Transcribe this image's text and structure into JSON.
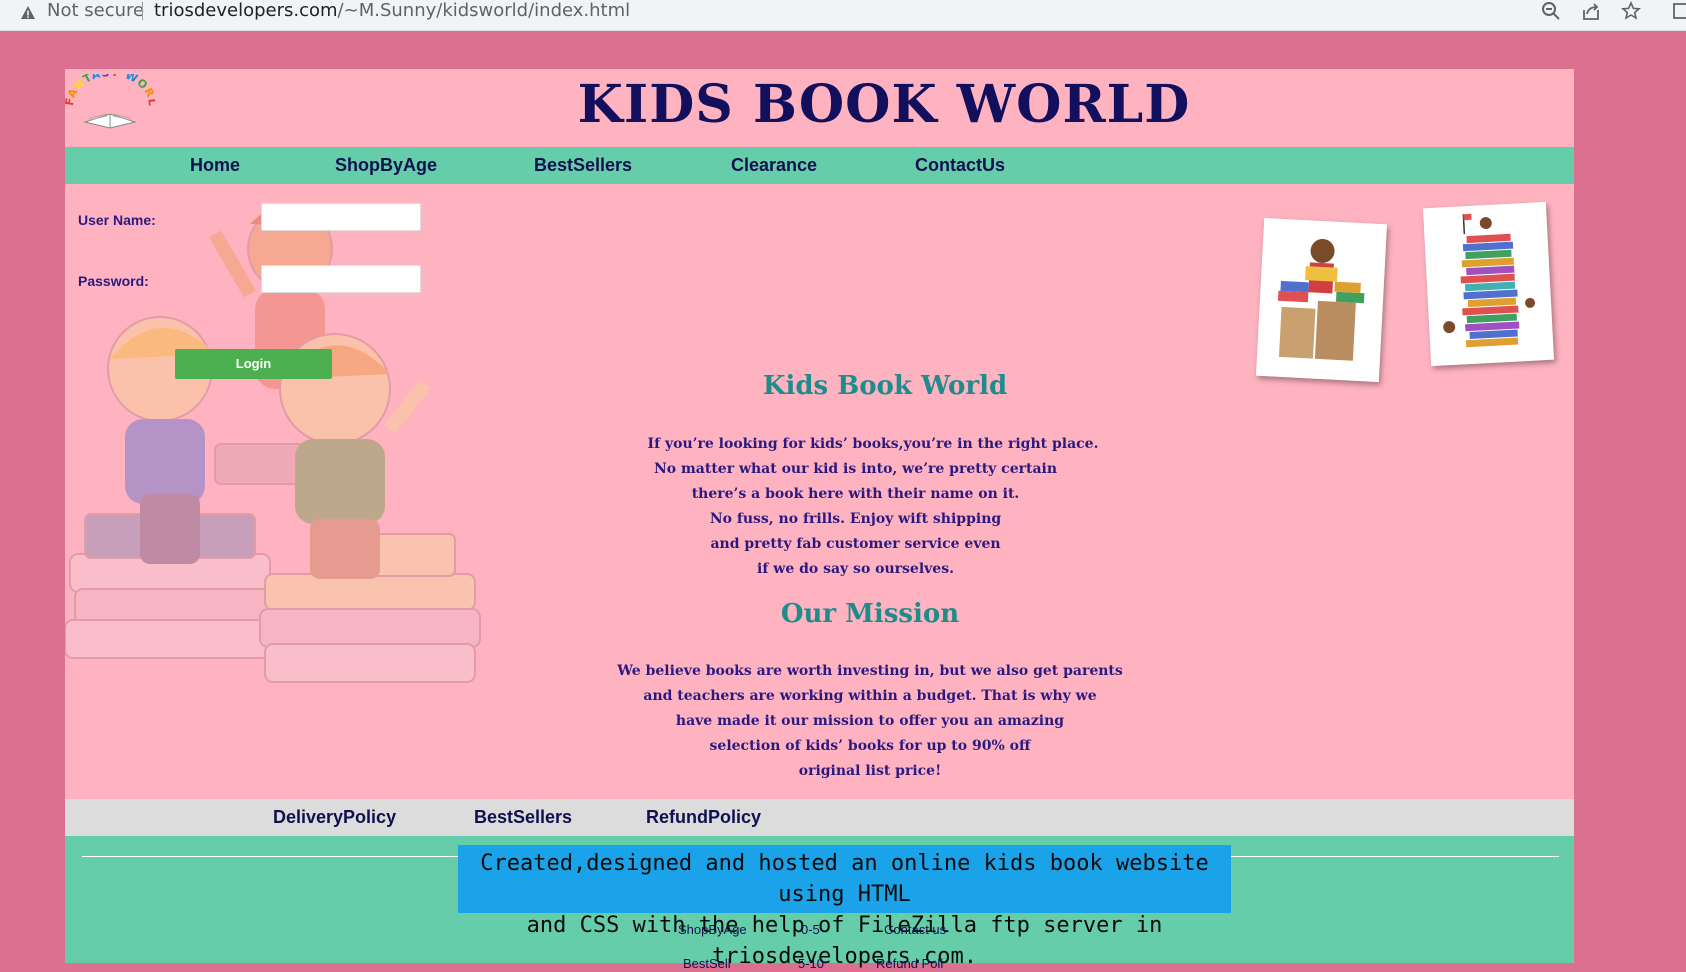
{
  "browser": {
    "security_label": "Not secure",
    "url_host": "triosdevelopers.com",
    "url_path": "/~M.Sunny/kidsworld/index.html"
  },
  "header": {
    "logo_text": "FANTASY WORLD",
    "title": "KIDS BOOK WORLD"
  },
  "nav": {
    "home": "Home",
    "shop_by_age": "ShopByAge",
    "bestsellers": "BestSellers",
    "clearance": "Clearance",
    "contact": "ContactUs"
  },
  "login": {
    "username_label": "User Name:",
    "password_label": "Password:",
    "username_value": "",
    "password_value": "",
    "button_label": "Login"
  },
  "about": {
    "heading": "Kids Book World",
    "lines": [
      "If you’re looking for kids’ books,you’re in the right place.",
      "No matter what our kid is into, we’re pretty certain",
      "there’s a book here with their name on it.",
      "No fuss, no frills. Enjoy wift shipping",
      "and pretty fab customer service even",
      "if we do say so ourselves."
    ]
  },
  "mission": {
    "heading": "Our Mission",
    "lines": [
      "We believe books are worth investing in, but we also get parents",
      "and teachers are working within a budget. That is why we",
      "have made it our mission to offer you an amazing",
      "selection of kids’ books for up to 90% off",
      "original list price!"
    ]
  },
  "footer_nav": {
    "delivery": "DeliveryPolicy",
    "bestsellers": "BestSellers",
    "refund": "RefundPolicy"
  },
  "footer": {
    "banner_line1": "Created,designed and hosted an online kids book website using HTML",
    "banner_line2": "and CSS with the help of FileZilla ftp server in triosdevelopers.com.",
    "row1": [
      "ShopByAge",
      "0-5",
      "Contact us"
    ],
    "row2": [
      "BestSell",
      "5-10",
      "Refund Poli"
    ]
  }
}
